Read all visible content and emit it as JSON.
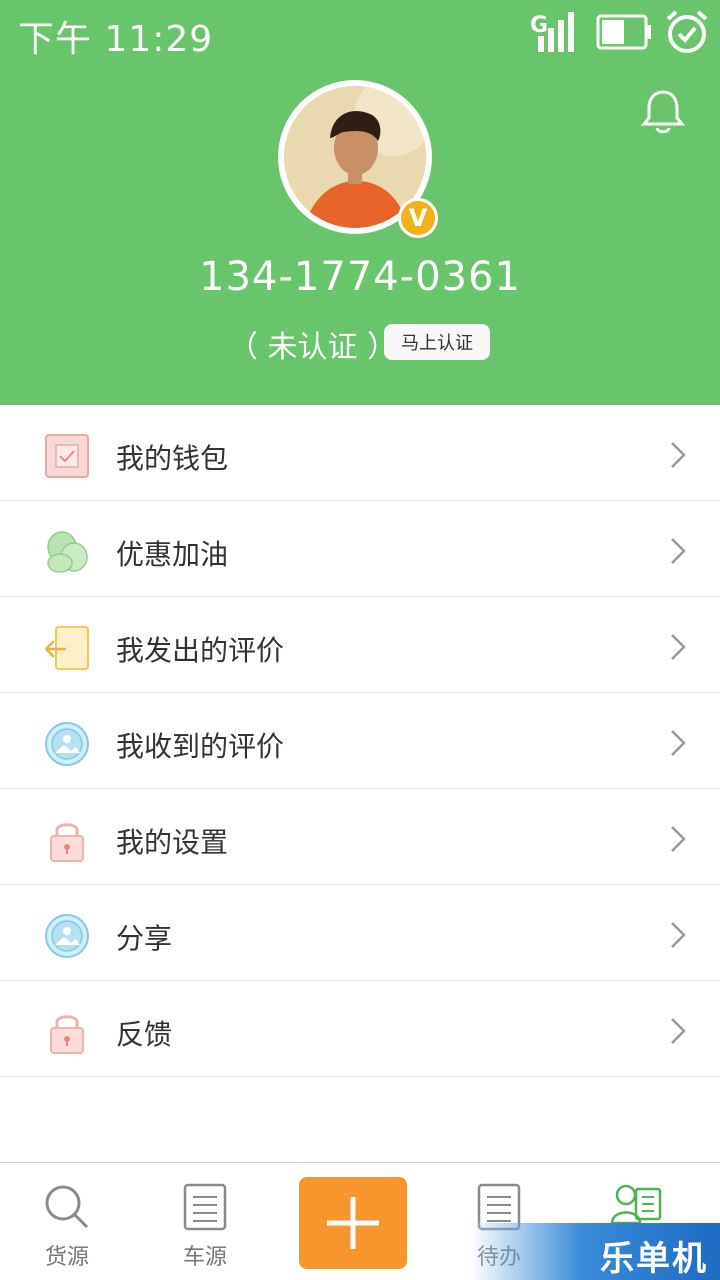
{
  "status_bar": {
    "time": "下午 11:29"
  },
  "profile": {
    "phone": "134-1774-0361",
    "cert_status": "（ 未认证 ）",
    "cert_button": "马上认证",
    "badge_letter": "V"
  },
  "menu": [
    {
      "label": "我的钱包",
      "icon": "wallet-icon"
    },
    {
      "label": "优惠加油",
      "icon": "coupon-icon"
    },
    {
      "label": "我发出的评价",
      "icon": "sent-review-icon"
    },
    {
      "label": "我收到的评价",
      "icon": "received-review-icon"
    },
    {
      "label": "我的设置",
      "icon": "lock-icon"
    },
    {
      "label": "分享",
      "icon": "share-icon"
    },
    {
      "label": "反馈",
      "icon": "lock-icon"
    }
  ],
  "bottom_nav": {
    "items": [
      {
        "label": "货源",
        "icon": "search-icon"
      },
      {
        "label": "车源",
        "icon": "list-icon"
      },
      {
        "label": "",
        "icon": "plus-icon"
      },
      {
        "label": "待办",
        "icon": "list-icon"
      },
      {
        "label": "",
        "icon": "profile-icon"
      }
    ]
  },
  "watermark": "乐单机",
  "colors": {
    "header_green": "#68c56b",
    "plus_orange": "#f7962c",
    "active_green": "#4cb450"
  }
}
